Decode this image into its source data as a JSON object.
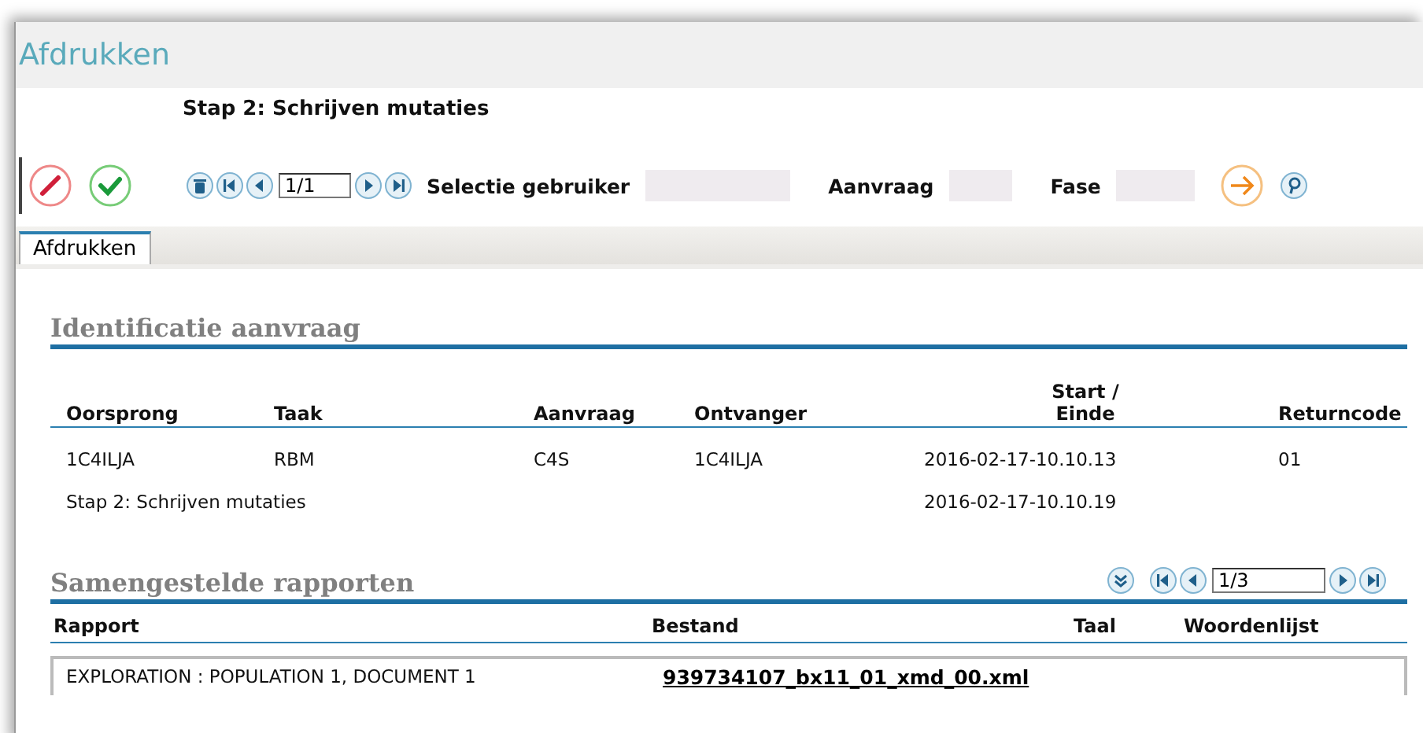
{
  "window": {
    "title": "Afdrukken"
  },
  "step_title": "Stap 2: Schrijven mutaties",
  "toolbar": {
    "pager_value": "1/1",
    "filters": [
      {
        "label": "Selectie gebruiker"
      },
      {
        "label": "Aanvraag"
      },
      {
        "label": "Fase"
      }
    ]
  },
  "tabs": [
    {
      "label": "Afdrukken",
      "selected": true
    }
  ],
  "identification": {
    "title": "Identificatie aanvraag",
    "columns": [
      "Oorsprong",
      "Taak",
      "Aanvraag",
      "Ontvanger",
      "Start /\nEinde",
      "Returncode"
    ],
    "rows": [
      [
        "1C4ILJA",
        "RBM",
        "C4S",
        "1C4ILJA",
        "2016-02-17-10.10.13",
        "01"
      ]
    ],
    "step": {
      "description": "Stap 2: Schrijven mutaties",
      "end": "2016-02-17-10.10.19"
    }
  },
  "reports": {
    "title": "Samengestelde rapporten",
    "pager_value": "1/3",
    "columns": [
      "Rapport",
      "Bestand",
      "Taal",
      "Woordenlijst"
    ],
    "rows": [
      {
        "report": "EXPLORATION : POPULATION 1, DOCUMENT 1",
        "file": "939734107_bx11_01_xmd_00.xml"
      }
    ]
  }
}
